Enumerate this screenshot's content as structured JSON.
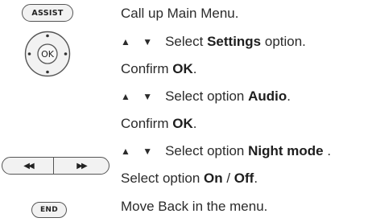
{
  "keys": {
    "assist": "ASSIST",
    "ok": "OK",
    "rewind": "◀◀",
    "forward": "▶▶",
    "end": "END"
  },
  "arrows": "▲ ▼",
  "steps": [
    {
      "pre": "Call up Main Menu.",
      "bold": "",
      "post": ""
    },
    {
      "pre": "Select ",
      "bold": "Settings",
      "post": " option."
    },
    {
      "pre": "Confirm ",
      "bold": "OK",
      "post": "."
    },
    {
      "pre": "Select option ",
      "bold": "Audio",
      "post": "."
    },
    {
      "pre": "Confirm ",
      "bold": "OK",
      "post": "."
    },
    {
      "pre": "Select option ",
      "bold": "Night mode",
      "post": " ."
    },
    {
      "pre": "Select option ",
      "bold": "On",
      "mid": " / ",
      "bold2": "Off",
      "post": "."
    },
    {
      "pre": "Move Back in the menu.",
      "bold": "",
      "post": ""
    }
  ]
}
